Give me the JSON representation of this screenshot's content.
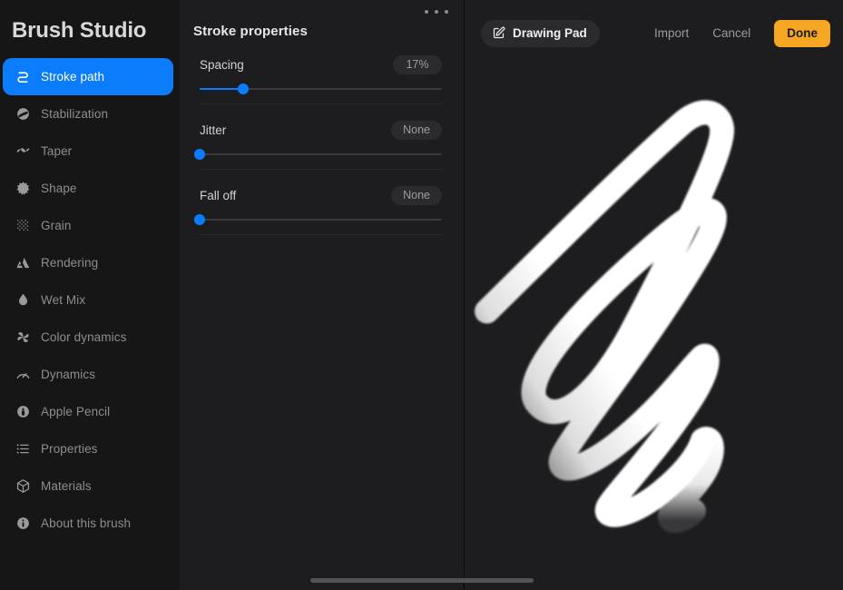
{
  "sidebar": {
    "title": "Brush Studio",
    "items": [
      {
        "label": "Stroke path",
        "icon": "stroke-path-icon",
        "selected": true
      },
      {
        "label": "Stabilization",
        "icon": "stabilization-icon",
        "selected": false
      },
      {
        "label": "Taper",
        "icon": "taper-wave-icon",
        "selected": false
      },
      {
        "label": "Shape",
        "icon": "shape-starburst-icon",
        "selected": false
      },
      {
        "label": "Grain",
        "icon": "grain-dots-icon",
        "selected": false
      },
      {
        "label": "Rendering",
        "icon": "rendering-peaks-icon",
        "selected": false
      },
      {
        "label": "Wet Mix",
        "icon": "wet-mix-droplet-icon",
        "selected": false
      },
      {
        "label": "Color dynamics",
        "icon": "color-pinwheel-icon",
        "selected": false
      },
      {
        "label": "Dynamics",
        "icon": "dynamics-gauge-icon",
        "selected": false
      },
      {
        "label": "Apple Pencil",
        "icon": "apple-pencil-icon",
        "selected": false
      },
      {
        "label": "Properties",
        "icon": "properties-list-icon",
        "selected": false
      },
      {
        "label": "Materials",
        "icon": "materials-cube-icon",
        "selected": false
      },
      {
        "label": "About this brush",
        "icon": "info-circle-icon",
        "selected": false
      }
    ]
  },
  "properties_panel": {
    "title": "Stroke properties",
    "menu_icon": "more-dots-icon",
    "sliders": [
      {
        "label": "Spacing",
        "value_text": "17%",
        "percent": 18
      },
      {
        "label": "Jitter",
        "value_text": "None",
        "percent": 0
      },
      {
        "label": "Fall off",
        "value_text": "None",
        "percent": 0
      }
    ]
  },
  "preview": {
    "drawing_pad_label": "Drawing Pad",
    "drawing_pad_icon": "edit-square-icon",
    "import_label": "Import",
    "cancel_label": "Cancel",
    "done_label": "Done"
  },
  "colors": {
    "accent_blue": "#0a7cfc",
    "accent_orange": "#f5a623",
    "sidebar_bg": "#161616",
    "panel_bg": "#1d1d1f",
    "stroke_white": "#ffffff"
  }
}
